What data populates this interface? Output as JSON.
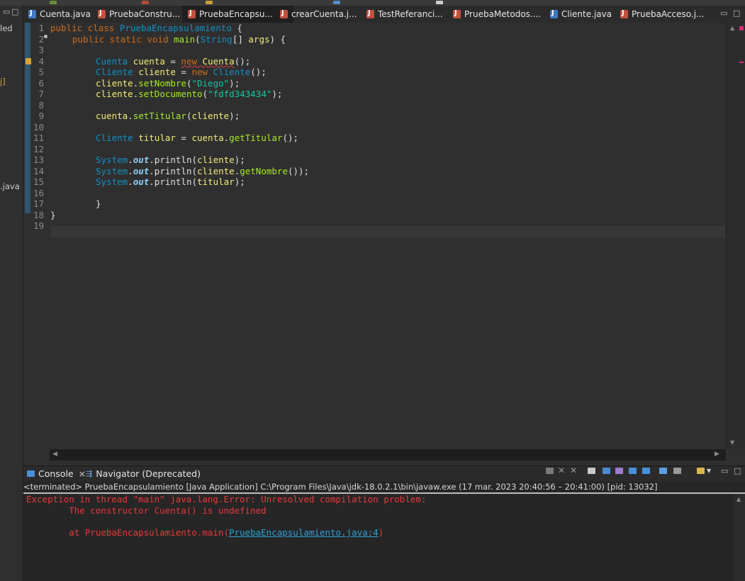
{
  "left_panel": {
    "fragments": [
      "led",
      "j]",
      ".java"
    ]
  },
  "editor_tabs": [
    {
      "label": "Cuenta.java",
      "icon": "java-class-icon"
    },
    {
      "label": "PruebaConstru...",
      "icon": "java-runnable-icon"
    },
    {
      "label": "PruebaEncapsu...",
      "icon": "java-runnable-icon",
      "active": true
    },
    {
      "label": "crearCuenta.j...",
      "icon": "java-runnable-icon"
    },
    {
      "label": "TestReferanci...",
      "icon": "java-runnable-icon"
    },
    {
      "label": "PruebaMetodos....",
      "icon": "java-runnable-icon"
    },
    {
      "label": "Cliente.java",
      "icon": "java-class-icon"
    },
    {
      "label": "PruebaAcceso.j...",
      "icon": "java-runnable-icon"
    }
  ],
  "editor": {
    "line_numbers": [
      "1",
      "2",
      "3",
      "4",
      "5",
      "6",
      "7",
      "8",
      "9",
      "10",
      "11",
      "12",
      "13",
      "14",
      "15",
      "16",
      "17",
      "18",
      "19"
    ],
    "code": {
      "l1": [
        "public",
        " ",
        "class",
        " ",
        "PruebaEncapsulamiento",
        " {"
      ],
      "l2": [
        "public",
        " ",
        "static",
        " ",
        "void",
        " ",
        "main",
        "(",
        "String",
        "[] ",
        "args",
        ") {"
      ],
      "l4": [
        "Cuenta",
        " ",
        "cuenta",
        " = ",
        "new",
        " ",
        "Cuenta",
        "();"
      ],
      "l5": [
        "Cliente",
        " ",
        "cliente",
        " = ",
        "new",
        " ",
        "Cliente",
        "();"
      ],
      "l6": [
        "cliente",
        ".",
        "setNombre",
        "(",
        "\"Diego\"",
        ");"
      ],
      "l7": [
        "cliente",
        ".",
        "setDocumento",
        "(",
        "\"fdfd343434\"",
        ");"
      ],
      "l9": [
        "cuenta",
        ".",
        "setTitular",
        "(",
        "cliente",
        ");"
      ],
      "l11": [
        "Cliente",
        " ",
        "titular",
        " = ",
        "cuenta",
        ".",
        "getTitular",
        "();"
      ],
      "l13": [
        "System",
        ".",
        "out",
        ".",
        "println",
        "(",
        "cliente",
        ");"
      ],
      "l14": [
        "System",
        ".",
        "out",
        ".",
        "println",
        "(",
        "cliente",
        ".",
        "getNombre",
        "());"
      ],
      "l15": [
        "System",
        ".",
        "out",
        ".",
        "println",
        "(",
        "titular",
        ");"
      ],
      "l17": "}",
      "l18": "}"
    }
  },
  "console": {
    "tabs": [
      {
        "label": "Console",
        "icon": "console-icon",
        "active": true
      },
      {
        "label": "Navigator (Deprecated)",
        "icon": "navigator-icon"
      }
    ],
    "status": "<terminated> PruebaEncapsulamiento [Java Application] C:\\Program Files\\Java\\jdk-18.0.2.1\\bin\\javaw.exe  (17 mar. 2023 20:40:56 – 20:41:00) [pid: 13032]",
    "lines": {
      "exception": "Exception in thread \"main\" java.lang.Error: Unresolved compilation problem: ",
      "detail": "        The constructor Cuenta() is undefined",
      "at_prefix": "        at PruebaEncapsulamiento.main(",
      "at_link": "PruebaEncapsulamiento.java:4",
      "at_suffix": ")"
    }
  },
  "colors": {
    "keyword": "#cc6c1d",
    "class": "#1290c3",
    "method": "#a7ec21",
    "variable": "#f3ec79",
    "string": "#17c6a3",
    "error_text": "#e53a3a",
    "link": "#2f9fd5"
  }
}
